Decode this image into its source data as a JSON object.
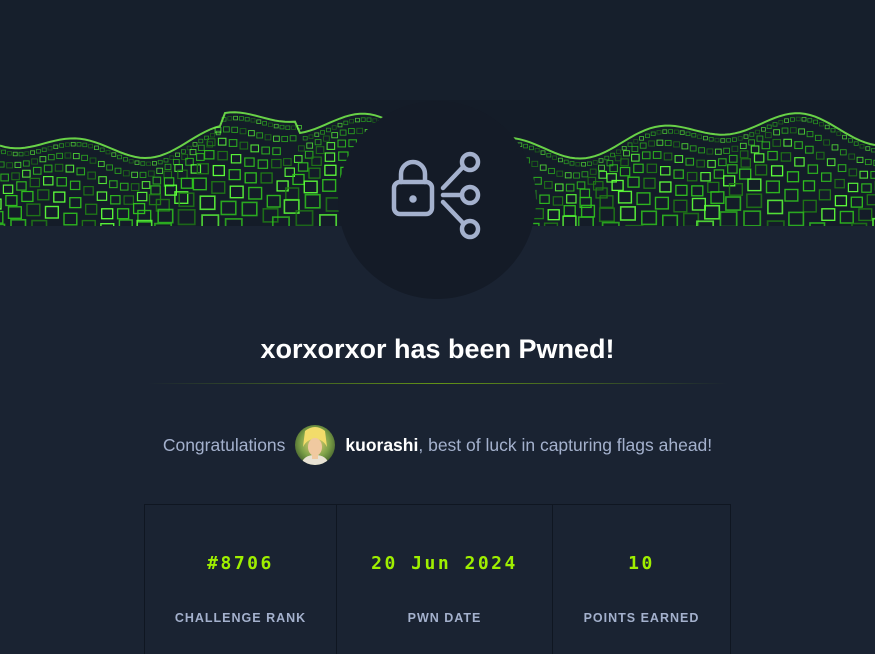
{
  "header": {
    "emblem_icon": "lock-share-icon",
    "banner_graphic": "green-cube-wave"
  },
  "title": "xorxorxor has been Pwned!",
  "congrats": {
    "prefix": "Congratulations",
    "username": "kuorashi",
    "suffix": ", best of luck in capturing flags ahead!",
    "avatar_icon": "user-avatar"
  },
  "stats": [
    {
      "value": "#8706",
      "label": "CHALLENGE RANK"
    },
    {
      "value": "20 Jun 2024",
      "label": "PWN DATE"
    },
    {
      "value": "10",
      "label": "POINTS EARNED"
    }
  ],
  "colors": {
    "background": "#1a2332",
    "accent": "#9fef00",
    "muted_text": "#a4b1cd",
    "emblem_bg": "#141b27"
  }
}
